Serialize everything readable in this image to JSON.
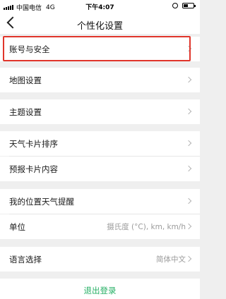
{
  "status_bar": {
    "carrier": "中国电信",
    "network": "4G",
    "time": "下午4:07"
  },
  "nav": {
    "title": "个性化设置"
  },
  "settings": [
    {
      "label": "账号与安全",
      "value": ""
    },
    {
      "label": "地图设置",
      "value": ""
    },
    {
      "label": "主题设置",
      "value": ""
    },
    {
      "label": "天气卡片排序",
      "value": ""
    },
    {
      "label": "预报卡片内容",
      "value": ""
    },
    {
      "label": "我的位置天气提醒",
      "value": ""
    },
    {
      "label": "单位",
      "value": "摄氏度 (°C), km, km/h"
    },
    {
      "label": "语言选择",
      "value": "简体中文"
    }
  ],
  "logout": {
    "label": "退出登录"
  },
  "colors": {
    "highlight": "#e0352b",
    "logout_text": "#27b066"
  }
}
